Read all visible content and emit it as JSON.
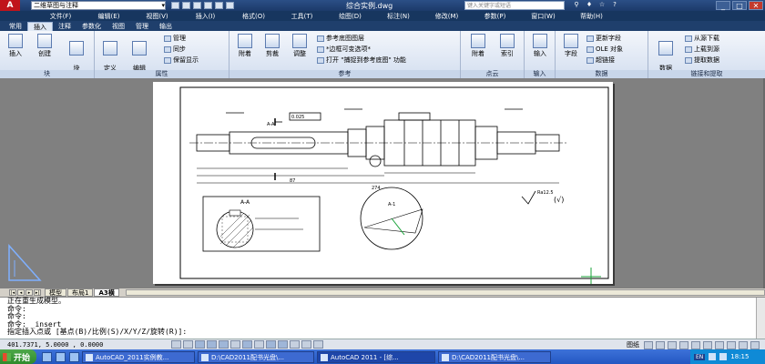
{
  "titlebar": {
    "workspace": "二维草图与注释",
    "title": "综合实例.dwg",
    "search_placeholder": "键入关键字或短语"
  },
  "menu": [
    "文件(F)",
    "编辑(E)",
    "视图(V)",
    "插入(I)",
    "格式(O)",
    "工具(T)",
    "绘图(D)",
    "标注(N)",
    "修改(M)",
    "参数(P)",
    "窗口(W)",
    "帮助(H)"
  ],
  "ribbon_tabs": [
    "常用",
    "插入",
    "注释",
    "参数化",
    "视图",
    "管理",
    "输出"
  ],
  "ribbon_active_tab": "插入",
  "ribbon": {
    "block": {
      "title": "块",
      "insert": "插入",
      "create": "创建",
      "editor": "块\n编辑器"
    },
    "attributes": {
      "title": "属性",
      "define": "定义\n属性",
      "edit": "编辑\n属性",
      "manage": "管理",
      "sync": "同步",
      "keep_display": "保留显示"
    },
    "reference": {
      "title": "参考",
      "attach": "附着",
      "clip": "剪裁",
      "adjust": "调整",
      "ref_layer": "参考底图图层",
      "frame": "*边框可变选项*",
      "snap_underlay": "打开 \"捕捉到参考底图\" 功能"
    },
    "pointcloud": {
      "title": "点云",
      "attach": "附着",
      "index": "索引"
    },
    "import": {
      "title": "输入",
      "import": "输入"
    },
    "data": {
      "title": "数据",
      "field": "字段",
      "update_fields": "更新字段",
      "ole": "OLE 对象",
      "hyperlink": "超链接"
    },
    "link": {
      "title": "链接和提取",
      "data_link": "数据\n链接",
      "download": "从源下载",
      "upload": "上载到源",
      "extract": "提取数据"
    }
  },
  "drawing": {
    "section_label": "A-A",
    "detail_label": "A-1",
    "roughness_note": "Ra12.5",
    "dim_total": "274",
    "dim_mid": "87",
    "dim_d": "Ø",
    "tol": "0.025"
  },
  "layout_tabs": [
    "模型",
    "布局1",
    "A3横"
  ],
  "layout_active": "A3横",
  "command_lines": [
    "正在重生成模型。",
    "命令:",
    "命令:",
    "命令: _insert"
  ],
  "command_prompt": "指定插入点或 [基点(B)/比例(S)/X/Y/Z/旋转(R)]:",
  "status": {
    "coords": "401.7371, 5.0000 , 0.0000",
    "paper_label": "图纸"
  },
  "taskbar": {
    "start": "开始",
    "tasks": [
      "AutoCAD_2011实例教...",
      "D:\\CAD2011配书光盘\\...",
      "AutoCAD 2011 - [综...",
      "D:\\CAD2011配书光盘\\..."
    ],
    "active_task": 2,
    "lang": "EN",
    "time": "18:15"
  }
}
